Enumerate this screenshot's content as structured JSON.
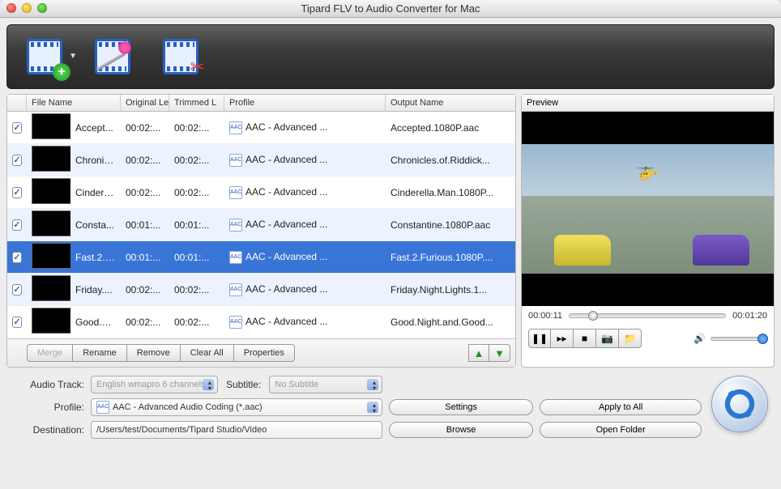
{
  "window_title": "Tipard FLV to Audio Converter for Mac",
  "columns": {
    "filename": "File Name",
    "original": "Original Le",
    "trimmed": "Trimmed L",
    "profile": "Profile",
    "output": "Output Name"
  },
  "rows": [
    {
      "name": "Accept...",
      "orig": "00:02:...",
      "trim": "00:02:...",
      "prof": "AAC - Advanced ...",
      "out": "Accepted.1080P.aac"
    },
    {
      "name": "Chronic...",
      "orig": "00:02:...",
      "trim": "00:02:...",
      "prof": "AAC - Advanced ...",
      "out": "Chronicles.of.Riddick..."
    },
    {
      "name": "Cindere...",
      "orig": "00:02:...",
      "trim": "00:02:...",
      "prof": "AAC - Advanced ...",
      "out": "Cinderella.Man.1080P..."
    },
    {
      "name": "Consta...",
      "orig": "00:01:...",
      "trim": "00:01:...",
      "prof": "AAC - Advanced ...",
      "out": "Constantine.1080P.aac"
    },
    {
      "name": "Fast.2.F...",
      "orig": "00:01:...",
      "trim": "00:01:...",
      "prof": "AAC - Advanced ...",
      "out": "Fast.2.Furious.1080P...."
    },
    {
      "name": "Friday....",
      "orig": "00:02:...",
      "trim": "00:02:...",
      "prof": "AAC - Advanced ...",
      "out": "Friday.Night.Lights.1..."
    },
    {
      "name": "Good.N...",
      "orig": "00:02:...",
      "trim": "00:02:...",
      "prof": "AAC - Advanced ...",
      "out": "Good.Night.and.Good..."
    }
  ],
  "list_buttons": {
    "merge": "Merge",
    "rename": "Rename",
    "remove": "Remove",
    "clear": "Clear All",
    "props": "Properties"
  },
  "preview": {
    "label": "Preview",
    "current_time": "00:00:11",
    "total_time": "00:01:20"
  },
  "form": {
    "audio_track_label": "Audio Track:",
    "audio_track_value": "English wmapro 6 channels",
    "subtitle_label": "Subtitle:",
    "subtitle_value": "No Subtitle",
    "profile_label": "Profile:",
    "profile_value": "AAC - Advanced Audio Coding (*.aac)",
    "destination_label": "Destination:",
    "destination_value": "/Users/test/Documents/Tipard Studio/Video",
    "settings": "Settings",
    "apply_all": "Apply to All",
    "browse": "Browse",
    "open_folder": "Open Folder"
  }
}
